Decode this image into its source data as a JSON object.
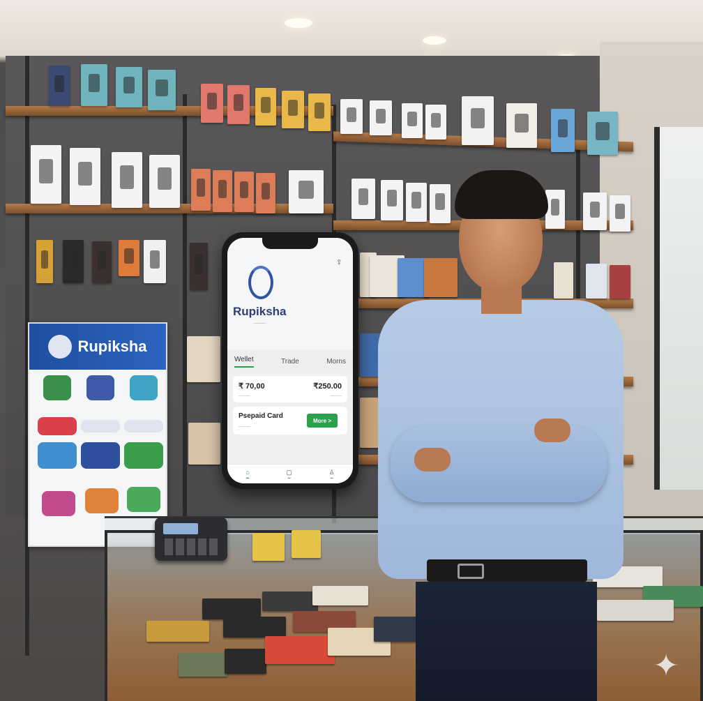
{
  "poster": {
    "brand": "Rupiksha"
  },
  "phone": {
    "app_name": "Rupiksha",
    "tabs": [
      {
        "label": "Wellet",
        "active": true
      },
      {
        "label": "Trade",
        "active": false
      },
      {
        "label": "Morns",
        "active": false
      }
    ],
    "balances": [
      {
        "amount": "₹ 70,00"
      },
      {
        "amount": "₹250.00"
      }
    ],
    "card": {
      "title": "Psepaid Card",
      "button_label": "More >"
    },
    "nav_icons": [
      "home-icon",
      "document-icon",
      "profile-icon"
    ],
    "accent": "#2aa14a",
    "brand_color": "#2c3f7a"
  },
  "colors": {
    "shirt": "#a9c0e0",
    "shelf": "#9b6638",
    "wall": "#555353"
  }
}
